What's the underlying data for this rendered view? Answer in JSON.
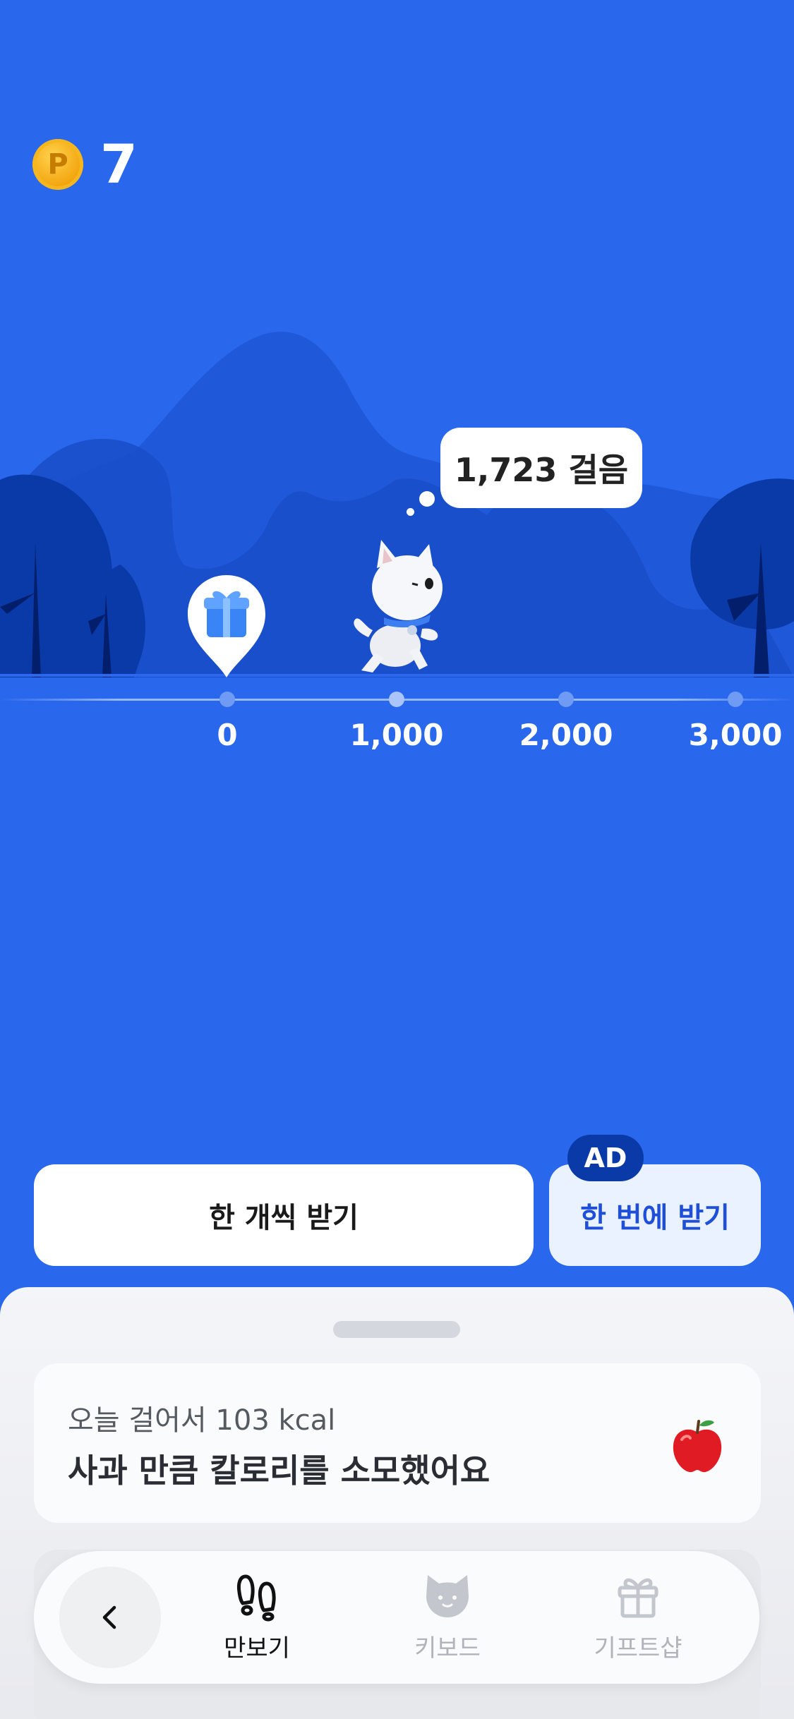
{
  "points": {
    "value": "7",
    "coin_glyph": "P"
  },
  "steps_bubble": "1,723 걸음",
  "progress": {
    "current_steps": 1723,
    "ticks": [
      {
        "label": "0"
      },
      {
        "label": "1,000"
      },
      {
        "label": "2,000"
      },
      {
        "label": "3,000"
      }
    ]
  },
  "actions": {
    "collect_one_label": "한 개씩 받기",
    "collect_all_label": "한 번에 받기",
    "ad_badge": "AD"
  },
  "calorie_card": {
    "subtitle": "오늘 걸어서 103 kcal",
    "title": "사과 만큼 칼로리를 소모했어요",
    "icon": "apple-icon"
  },
  "nav": {
    "items": [
      {
        "label": "만보기",
        "icon": "footprints-icon",
        "active": true
      },
      {
        "label": "키보드",
        "icon": "cat-face-icon",
        "active": false
      },
      {
        "label": "기프트샵",
        "icon": "gift-icon",
        "active": false
      }
    ]
  },
  "colors": {
    "background": "#2967ec",
    "ad_badge": "#0a3aa8",
    "primary_text": "#1f4fd8"
  }
}
